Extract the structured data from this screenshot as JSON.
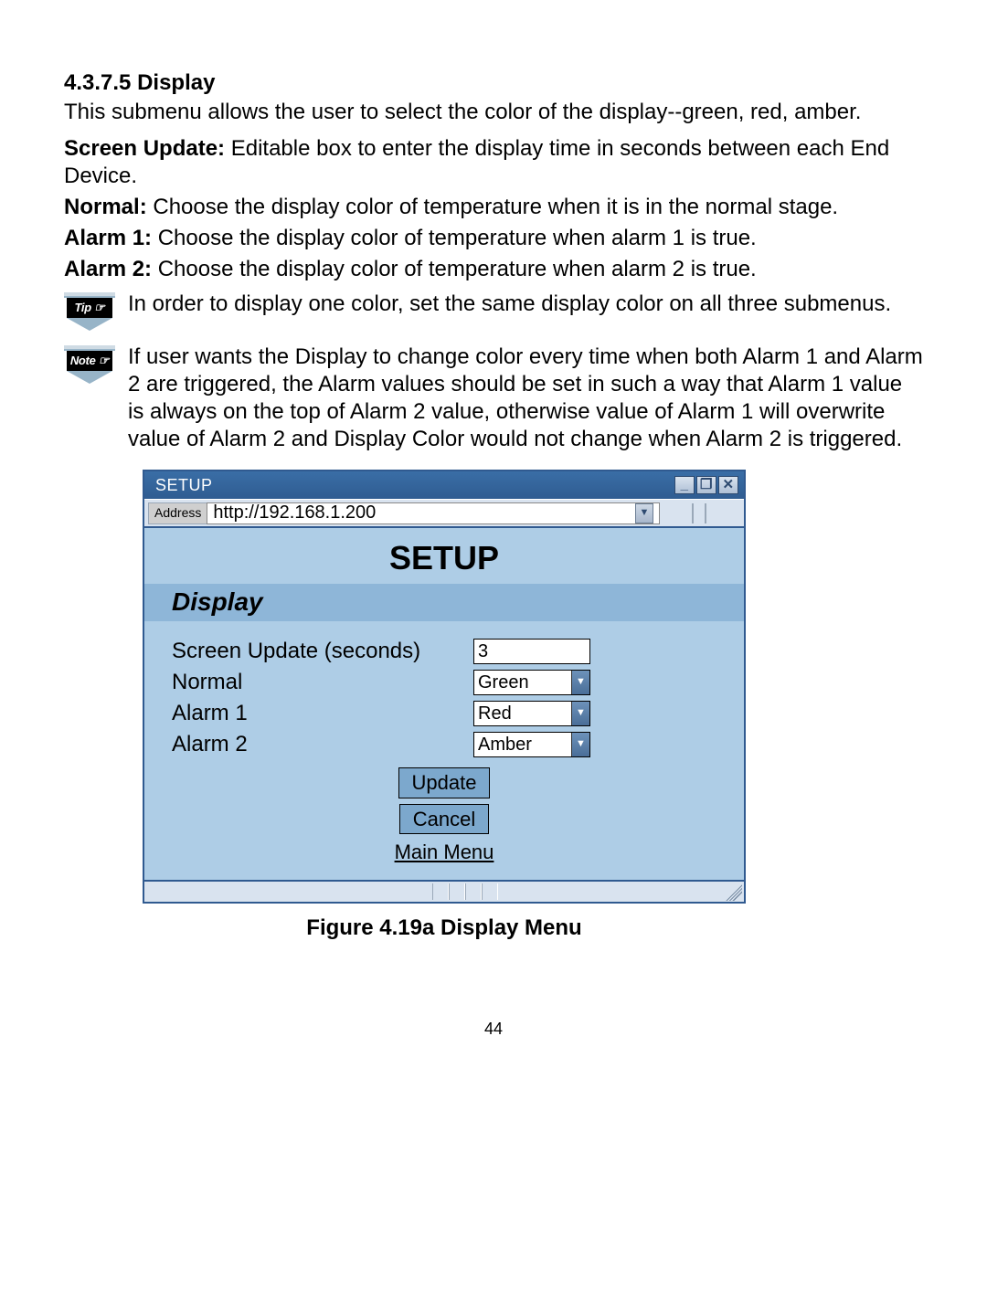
{
  "doc": {
    "section_number": "4.3.7.5",
    "section_title": "Display",
    "intro": "This submenu allows the user to select the color of the display--green, red, amber.",
    "screen_update_label": "Screen Update:",
    "screen_update_text": " Editable box to enter the display time in seconds between each End Device.",
    "normal_label": "Normal:",
    "normal_text": "  Choose the display color of temperature when it is in the normal stage.",
    "alarm1_label": "Alarm 1:",
    "alarm1_text": "  Choose the display color of temperature when alarm 1 is true.",
    "alarm2_label": "Alarm 2:",
    "alarm2_text": "  Choose the display color of temperature when alarm 2 is true.",
    "tip_badge": "Tip ☞",
    "tip_text": "In order to display one color, set the same display color on all three submenus.",
    "note_badge": "Note ☞",
    "note_text": "If user wants the Display to change color every time when both Alarm 1 and Alarm 2 are triggered, the Alarm values should be set in such a way that Alarm 1 value is always on the top of Alarm 2 value, otherwise value of Alarm 1 will overwrite value of Alarm 2 and Display Color would not change when Alarm 2 is triggered.",
    "figure_caption": "Figure 4.19a  Display Menu",
    "page_number": "44"
  },
  "window": {
    "title": "SETUP",
    "btn_min": "_",
    "btn_max": "❐",
    "btn_close": "✕",
    "address_label": "Address",
    "address_value": "http://192.168.1.200",
    "dd_glyph": "▼"
  },
  "setup": {
    "big_title": "SETUP",
    "panel_heading": "Display",
    "rows": {
      "screen_update_label": "Screen Update (seconds)",
      "screen_update_value": "3",
      "normal_label": "Normal",
      "normal_value": "Green",
      "alarm1_label": "Alarm 1",
      "alarm1_value": "Red",
      "alarm2_label": "Alarm 2",
      "alarm2_value": "Amber"
    },
    "buttons": {
      "update": "Update",
      "cancel": "Cancel",
      "main_menu": "Main Menu"
    }
  }
}
